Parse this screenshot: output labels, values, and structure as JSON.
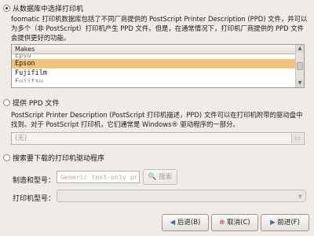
{
  "option_database": {
    "label": "从数据库中选择打印机",
    "description": "foomatic 打印机数据库包括了不同厂商提供的 PostScript Printer Description (PPD) 文件，并可以为多个（非 PostScript）打印机产生 PPD 文件。但是，在通常情况下，打印机厂商提供的 PPD 文件会提供更好的功能。"
  },
  "makes_list": {
    "header": "Makes",
    "rows": [
      "Epson",
      "Fujifilm"
    ],
    "partial_top": "Epso",
    "partial_bottom": "Fujitsu",
    "selected": "Epson"
  },
  "option_ppd": {
    "label": "提供 PPD 文件",
    "description": "PostScript Printer Description (PostScript 打印机描述，PPD) 文件可以在打印机附带的驱动盘中找到。对于 PostScript 打印机，它们通常是 Windows® 驱动程序的一部分。",
    "file_placeholder": "(无)"
  },
  "option_search": {
    "label": "搜索要下载的打印机驱动程序",
    "make_model_label": "制造和型号：",
    "make_model_value": "Generic text-only prir",
    "search_button": "搜索",
    "printer_model_label": "打印机型号："
  },
  "footer": {
    "back": "后退(B)",
    "cancel": "取消(C)",
    "forward": "前进(F)"
  }
}
